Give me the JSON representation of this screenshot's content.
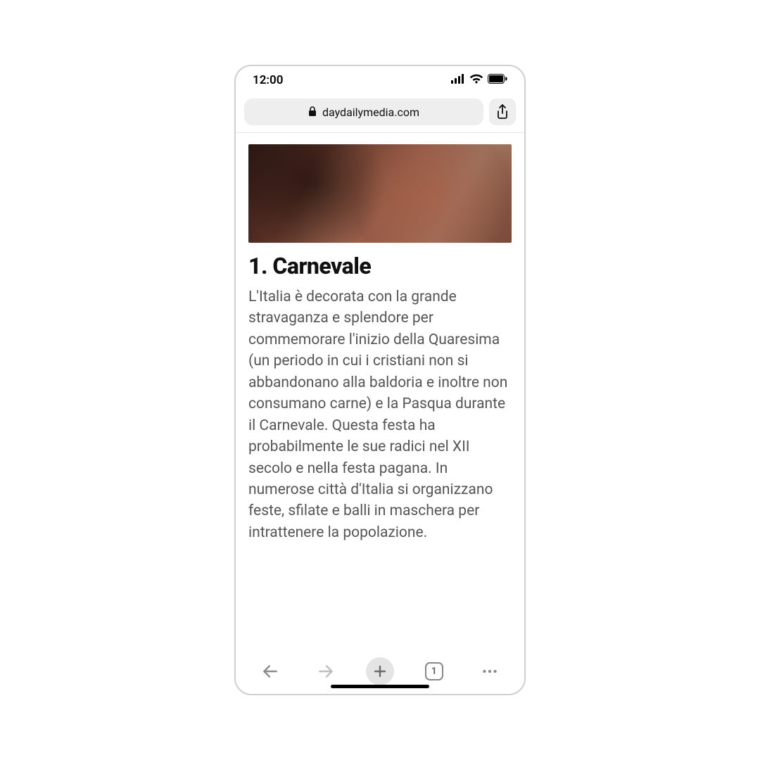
{
  "status": {
    "time": "12:00"
  },
  "url": {
    "domain": "daydailymedia.com"
  },
  "article": {
    "heading": "1. Carnevale",
    "body": "L'Italia è decorata con la grande stravaganza e splendore per commemorare l'inizio della Quaresima (un periodo in cui i cristiani non si abbandonano alla baldoria e inoltre non consumano carne) e la Pasqua durante il Carnevale. Questa festa ha probabilmente le sue radici nel XII secolo e nella festa pagana. In numerose città d'Italia si organizzano feste, sfilate e balli in maschera per intrattenere la popolazione."
  },
  "toolbar": {
    "tab_count": "1"
  }
}
